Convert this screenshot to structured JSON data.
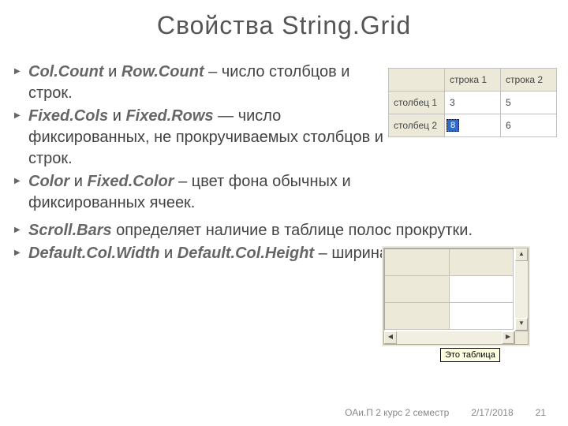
{
  "title": "Свойства String.Grid",
  "bullets": {
    "b1": {
      "k1": "Col.Count",
      "mid": " и ",
      "k2": "Row.Count",
      "rest": " – число столбцов и строк."
    },
    "b2": {
      "k1": "Fixed.Cols",
      "mid": " и ",
      "k2": "Fixed.Rows",
      "rest": " — число фиксированных, не прокручиваемых столбцов и строк."
    },
    "b3": {
      "k1": "Color",
      "mid": " и ",
      "k2": "Fixed.Color",
      "rest": "  – цвет фона обычных и фиксированных ячеек."
    },
    "b4": {
      "k1": "Scroll.Bars",
      "rest": "  определяет наличие в таблице полос прокрутки."
    },
    "b5": {
      "k1": "Default.Col.Width",
      "mid": " и ",
      "k2": "Default.Col.Height",
      "rest": " – ширина и высота ячеек."
    }
  },
  "grid1": {
    "h1": "строка 1",
    "h2": "строка 2",
    "r1": "столбец 1",
    "r2": "столбец 2",
    "c11": "3",
    "c12": "5",
    "c21": "8",
    "c22": "6"
  },
  "fig2": {
    "tooltip": "Это таблица",
    "up": "▲",
    "down": "▼",
    "left": "◀",
    "right": "▶"
  },
  "footer": {
    "course": "ОАи.П 2 курс 2 семестр",
    "date": "2/17/2018",
    "page": "21"
  }
}
